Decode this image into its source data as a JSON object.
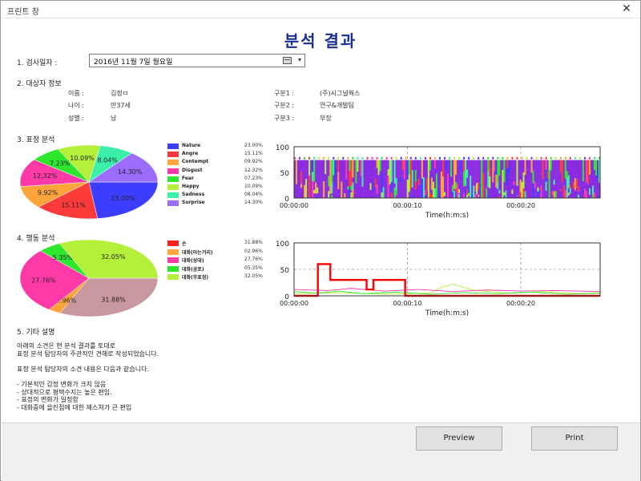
{
  "window": {
    "title": "프린트 창",
    "close_glyph": "✕"
  },
  "page_title": "분석 결과",
  "exam_date": {
    "label": "1. 검사일자 :",
    "value": "2016년 11월   7일 월요일"
  },
  "subject": {
    "section_label": "2. 대상자 정보",
    "fields": [
      {
        "label": "이름 :",
        "value": "김정ㅁ"
      },
      {
        "label": "나이 :",
        "value": "만37세"
      },
      {
        "label": "성별 :",
        "value": "남"
      }
    ],
    "groups": [
      {
        "label": "구분1 :",
        "value": "(주)시그널웍스"
      },
      {
        "label": "구분2 :",
        "value": "연구&개발팀"
      },
      {
        "label": "구분3 :",
        "value": "부장"
      }
    ]
  },
  "expression": {
    "section_label": "3. 표정 분석"
  },
  "behavior": {
    "section_label": "4. 행동 분석"
  },
  "remarks": {
    "section_label": "5. 기타 설명",
    "lines": [
      "아래의 소견은 현 분석 결과를 토대로",
      "표정 분석 탐당자의 주관적인 견해로 작성되었습니다.",
      "",
      "표정 분석 탐당자의 소견 내용은 다음과 같습니다.",
      "",
      "- 기본적인 감정 변화가 크지 않음",
      "- 상대적으로 평택수지는 높은 편임.",
      "- 표정의 변화가 일정함",
      "- 대화중에 을진점에 대한 제스쳐가 큰 편임"
    ]
  },
  "buttons": {
    "preview": "Preview",
    "print": "Print"
  },
  "chart_data": [
    {
      "type": "pie",
      "categories": [
        "Nature",
        "Angre",
        "Contempt",
        "Disgust",
        "Fear",
        "Happy",
        "Sadness",
        "Surprise"
      ],
      "values": [
        23.0,
        15.11,
        9.92,
        12.32,
        7.23,
        10.09,
        8.04,
        14.3
      ],
      "legend_labels": [
        "23.00%",
        "15.11%",
        "09.92%",
        "12.32%",
        "07.23%",
        "10.09%",
        "08.04%",
        "14.30%"
      ],
      "slice_labels": [
        "23.00%",
        "15.11%",
        "9.92%",
        "12.32%",
        "7.23%",
        "10.09%",
        "8.04%",
        "14.30%"
      ],
      "colors": [
        "#3d3dff",
        "#ff3a3a",
        "#ffa43a",
        "#ff3aa8",
        "#2ee62e",
        "#b4f03a",
        "#3af0a8",
        "#9c6cff"
      ],
      "legend_placement": "right"
    },
    {
      "type": "area",
      "x_ticks": [
        "00:00:00",
        "00:00:10",
        "00:00:20"
      ],
      "xlabel": "Time(h:m:s)",
      "y_ticks": [
        "100",
        "50",
        "0"
      ],
      "ylim": [
        0,
        100
      ],
      "grid": true,
      "colors": [
        "#8a2be2",
        "#3d3dff",
        "#ff3a3a",
        "#ffa43a",
        "#2ee62e",
        "#b4f03a",
        "#3af0a8",
        "#ff3aa8"
      ]
    },
    {
      "type": "pie",
      "categories": [
        "손",
        "대화(아는거리)",
        "대화(상대)",
        "대화(공포)",
        "대화(무표정)"
      ],
      "values": [
        31.88,
        2.96,
        27.76,
        5.35,
        32.05
      ],
      "legend_labels": [
        "31.88%",
        "02.96%",
        "27.76%",
        "05.35%",
        "32.05%"
      ],
      "slice_labels": [
        "31.88%",
        "2.96%",
        "27.76%",
        "5.35%",
        "32.05%"
      ],
      "colors": [
        "#c9979e",
        "#ffa43a",
        "#ff3aa8",
        "#2ee62e",
        "#b4f03a"
      ],
      "legend_colors": [
        "#ff2020",
        "#ffa43a",
        "#ff3aa8",
        "#2ee62e",
        "#b4f03a"
      ],
      "legend_placement": "right"
    },
    {
      "type": "line",
      "x_ticks": [
        "00:00:00",
        "00:00:10",
        "00:00:20"
      ],
      "xlabel": "Time(h:m:s)",
      "y_ticks": [
        "100",
        "50",
        "0"
      ],
      "ylim": [
        0,
        100
      ],
      "grid": true,
      "series": [
        {
          "color": "#ff0000",
          "x": [
            0,
            2.1,
            2.1,
            3.2,
            3.2,
            6.4,
            6.4,
            7.0,
            7.0,
            9.8,
            9.8,
            27
          ],
          "y": [
            0,
            0,
            60,
            60,
            30,
            30,
            12,
            12,
            30,
            30,
            0,
            0
          ]
        },
        {
          "color": "#ff3aa8",
          "x": [
            0,
            3,
            5,
            8,
            11,
            14,
            17,
            20,
            23,
            27
          ],
          "y": [
            12,
            10,
            14,
            9,
            12,
            8,
            11,
            9,
            10,
            8
          ]
        },
        {
          "color": "#2ee62e",
          "x": [
            0,
            2,
            4,
            6,
            9,
            12,
            15,
            18,
            21,
            24,
            27
          ],
          "y": [
            8,
            5,
            9,
            4,
            7,
            3,
            6,
            4,
            7,
            3,
            5
          ]
        },
        {
          "color": "#b4f03a",
          "x": [
            0,
            4,
            8,
            12,
            13,
            14,
            16,
            19,
            22,
            25,
            27
          ],
          "y": [
            4,
            6,
            3,
            5,
            16,
            22,
            10,
            5,
            8,
            4,
            6
          ]
        }
      ]
    }
  ]
}
